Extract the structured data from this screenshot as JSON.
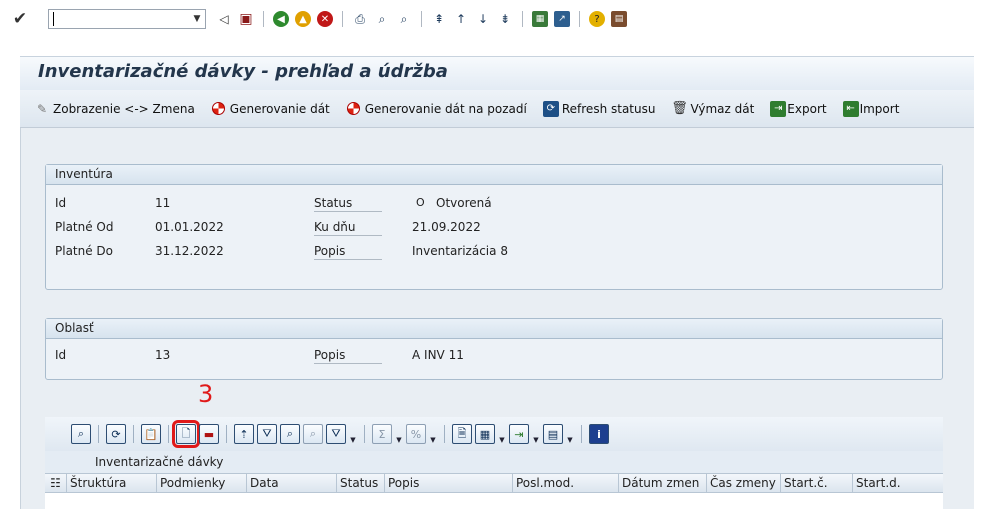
{
  "system": {
    "command_value": "",
    "icons": [
      "check-icon",
      "back-icon",
      "save-icon",
      "green-back-icon",
      "exit-icon",
      "cancel-icon",
      "print-icon",
      "find-icon",
      "find-next-icon",
      "first-page-icon",
      "prev-page-icon",
      "next-page-icon",
      "last-page-icon",
      "create-session-icon",
      "shortcut-icon",
      "help-icon",
      "customize-icon"
    ]
  },
  "title": "Inventarizačné dávky - prehľad a údržba",
  "toolbar": {
    "display_change": "Zobrazenie <-> Zmena",
    "generate": "Generovanie dát",
    "generate_bg": "Generovanie dát na pozadí",
    "refresh": "Refresh statusu",
    "delete": "Výmaz dát",
    "export": "Export",
    "import": "Import"
  },
  "inventory": {
    "heading": "Inventúra",
    "id_label": "Id",
    "id_value": "11",
    "valid_from_label": "Platné Od",
    "valid_from_value": "01.01.2022",
    "valid_to_label": "Platné Do",
    "valid_to_value": "31.12.2022",
    "status_label": "Status",
    "status_code": "O",
    "status_text": "Otvorená",
    "ku_dnu_label": "Ku dňu",
    "ku_dnu_value": "21.09.2022",
    "popis_label": "Popis",
    "popis_value": "Inventarizácia 8"
  },
  "area": {
    "heading": "Oblasť",
    "id_label": "Id",
    "id_value": "13",
    "popis_label": "Popis",
    "popis_value": "A INV 11"
  },
  "annotation": "3",
  "alv": {
    "title": "Inventarizačné dávky",
    "columns": [
      "Štruktúra",
      "Podmienky",
      "Data",
      "Status",
      "Popis",
      "Posl.mod.",
      "Dátum zmen",
      "Čas zmeny",
      "Start.č.",
      "Start.d."
    ]
  },
  "colors": {
    "highlight": "#e01919",
    "title": "#23364c"
  }
}
